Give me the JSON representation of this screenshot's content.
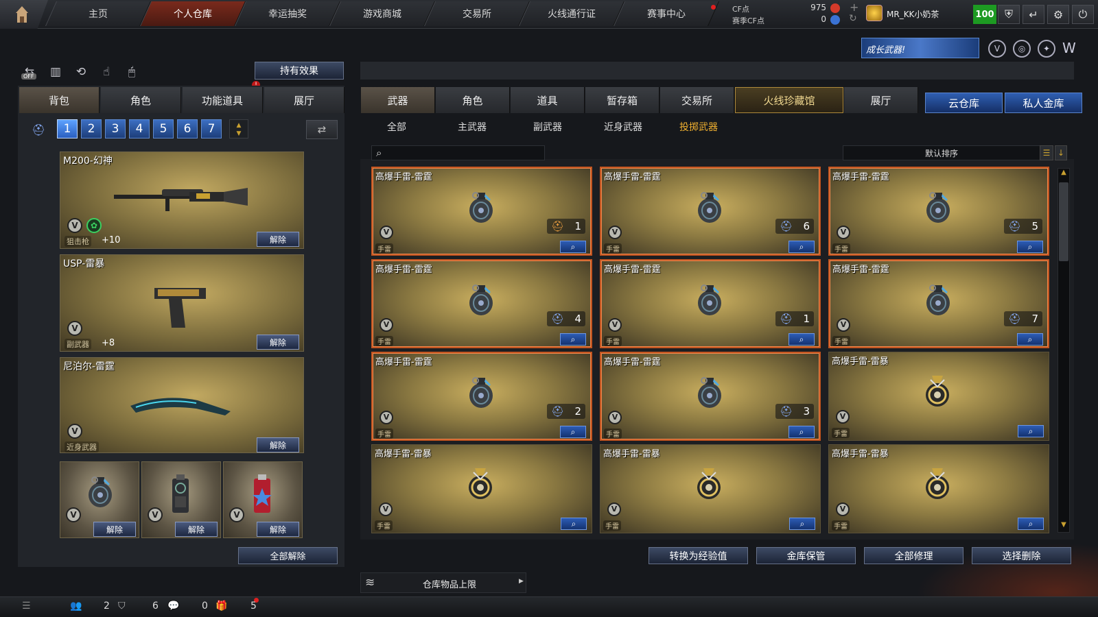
{
  "nav": {
    "tabs": [
      "主页",
      "个人仓库",
      "幸运抽奖",
      "游戏商城",
      "交易所",
      "火线通行证",
      "赛事中心"
    ],
    "active": 1
  },
  "account": {
    "cf_label": "CF点",
    "cf_value": "975",
    "season_label": "赛季CF点",
    "season_value": "0",
    "username": "MR_KK小奶茶",
    "level": "100"
  },
  "banner": {
    "growth_text": "成长武器!"
  },
  "left": {
    "hold_effect": "持有效果",
    "tabs": [
      "背包",
      "角色",
      "功能道具",
      "展厅"
    ],
    "slots": [
      "1",
      "2",
      "3",
      "4",
      "5",
      "6",
      "7"
    ],
    "equipped": [
      {
        "name": "M200-幻神",
        "type": "狙击枪",
        "bonus": "+10",
        "unequip": "解除"
      },
      {
        "name": "USP-雷暴",
        "type": "副武器",
        "bonus": "+8",
        "unequip": "解除"
      },
      {
        "name": "尼泊尔-雷霆",
        "type": "近身武器",
        "unequip": "解除"
      }
    ],
    "grenade_slots": [
      {
        "unequip": "解除"
      },
      {
        "unequip": "解除"
      },
      {
        "unequip": "解除"
      }
    ],
    "unequip_all": "全部解除"
  },
  "right": {
    "tabs": [
      "武器",
      "角色",
      "道具",
      "暂存箱",
      "交易所",
      "火线珍藏馆",
      "展厅"
    ],
    "cloud_tabs": [
      "云仓库",
      "私人金库"
    ],
    "subtabs": [
      "全部",
      "主武器",
      "副武器",
      "近身武器",
      "投掷武器"
    ],
    "search_placeholder": "",
    "sort_label": "默认排序",
    "items": [
      {
        "name": "高爆手雷-雷霆",
        "type": "手雷",
        "qty": "1",
        "highlight": true,
        "badge": "orange"
      },
      {
        "name": "高爆手雷-雷霆",
        "type": "手雷",
        "qty": "6",
        "highlight": true,
        "badge": "blue"
      },
      {
        "name": "高爆手雷-雷霆",
        "type": "手雷",
        "qty": "5",
        "highlight": true,
        "badge": "blue"
      },
      {
        "name": "高爆手雷-雷霆",
        "type": "手雷",
        "qty": "4",
        "highlight": true,
        "badge": "blue"
      },
      {
        "name": "高爆手雷-雷霆",
        "type": "手雷",
        "qty": "1",
        "highlight": true,
        "badge": "blue"
      },
      {
        "name": "高爆手雷-雷霆",
        "type": "手雷",
        "qty": "7",
        "highlight": true,
        "badge": "blue"
      },
      {
        "name": "高爆手雷-雷霆",
        "type": "手雷",
        "qty": "2",
        "highlight": true,
        "badge": "blue"
      },
      {
        "name": "高爆手雷-雷霆",
        "type": "手雷",
        "qty": "3",
        "highlight": true,
        "badge": "blue"
      },
      {
        "name": "高爆手雷-雷暴",
        "type": "手雷",
        "qty": "",
        "highlight": false,
        "badge": ""
      },
      {
        "name": "高爆手雷-雷暴",
        "type": "手雷",
        "qty": "",
        "highlight": false,
        "badge": ""
      },
      {
        "name": "高爆手雷-雷暴",
        "type": "手雷",
        "qty": "",
        "highlight": false,
        "badge": ""
      },
      {
        "name": "高爆手雷-雷暴",
        "type": "手雷",
        "qty": "",
        "highlight": false,
        "badge": ""
      }
    ],
    "actions": [
      "转换为经验值",
      "金库保管",
      "全部修理",
      "选择删除"
    ],
    "storage_limit": "仓库物品上限"
  },
  "status": {
    "friends": "2",
    "guild": "6",
    "messages": "0",
    "gifts": "5"
  },
  "colors": {
    "accent_blue": "#2d5cb5",
    "highlight_orange": "#c2541f",
    "gold_text": "#f0b030",
    "level_green": "#1d9a22"
  }
}
